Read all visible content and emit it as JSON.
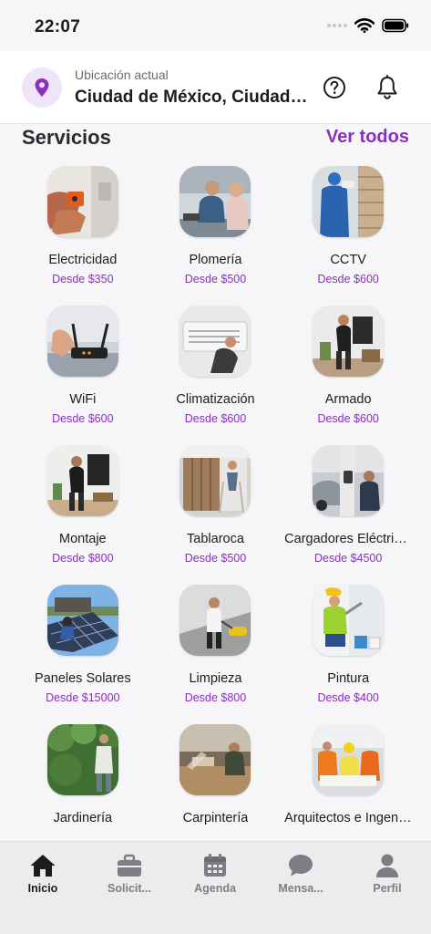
{
  "status": {
    "time": "22:07"
  },
  "header": {
    "location_label": "Ubicación actual",
    "location_value": "Ciudad de México, Ciudad de México"
  },
  "section": {
    "title": "Servicios",
    "see_all": "Ver todos"
  },
  "services": [
    {
      "name": "Electricidad",
      "price": "Desde $350",
      "icon": "electrician-photo"
    },
    {
      "name": "Plomería",
      "price": "Desde $500",
      "icon": "plumber-photo"
    },
    {
      "name": "CCTV",
      "price": "Desde $600",
      "icon": "cctv-installer-photo"
    },
    {
      "name": "WiFi",
      "price": "Desde $600",
      "icon": "router-photo"
    },
    {
      "name": "Climatización",
      "price": "Desde $600",
      "icon": "air-conditioner-photo"
    },
    {
      "name": "Armado",
      "price": "Desde $600",
      "icon": "assembly-photo"
    },
    {
      "name": "Montaje",
      "price": "Desde $800",
      "icon": "tv-mounting-photo"
    },
    {
      "name": "Tablaroca",
      "price": "Desde $500",
      "icon": "drywall-photo"
    },
    {
      "name": "Cargadores Eléctricos",
      "price": "Desde $4500",
      "icon": "ev-charger-photo"
    },
    {
      "name": "Paneles Solares",
      "price": "Desde $15000",
      "icon": "solar-panels-photo"
    },
    {
      "name": "Limpieza",
      "price": "Desde $800",
      "icon": "cleaning-photo"
    },
    {
      "name": "Pintura",
      "price": "Desde $400",
      "icon": "painter-photo"
    },
    {
      "name": "Jardinería",
      "price": "",
      "icon": "gardening-photo"
    },
    {
      "name": "Carpintería",
      "price": "",
      "icon": "carpentry-photo"
    },
    {
      "name": "Arquitectos e Ingenieros",
      "price": "",
      "icon": "architects-photo"
    }
  ],
  "tabs": [
    {
      "label": "Inicio",
      "icon": "home-icon",
      "active": true
    },
    {
      "label": "Solicit...",
      "icon": "briefcase-icon",
      "active": false
    },
    {
      "label": "Agenda",
      "icon": "calendar-icon",
      "active": false
    },
    {
      "label": "Mensa...",
      "icon": "chat-icon",
      "active": false
    },
    {
      "label": "Perfil",
      "icon": "person-icon",
      "active": false
    }
  ],
  "colors": {
    "accent": "#8a2fc2",
    "accent_light": "#efe4f9",
    "tab_inactive": "#7d7d82"
  }
}
